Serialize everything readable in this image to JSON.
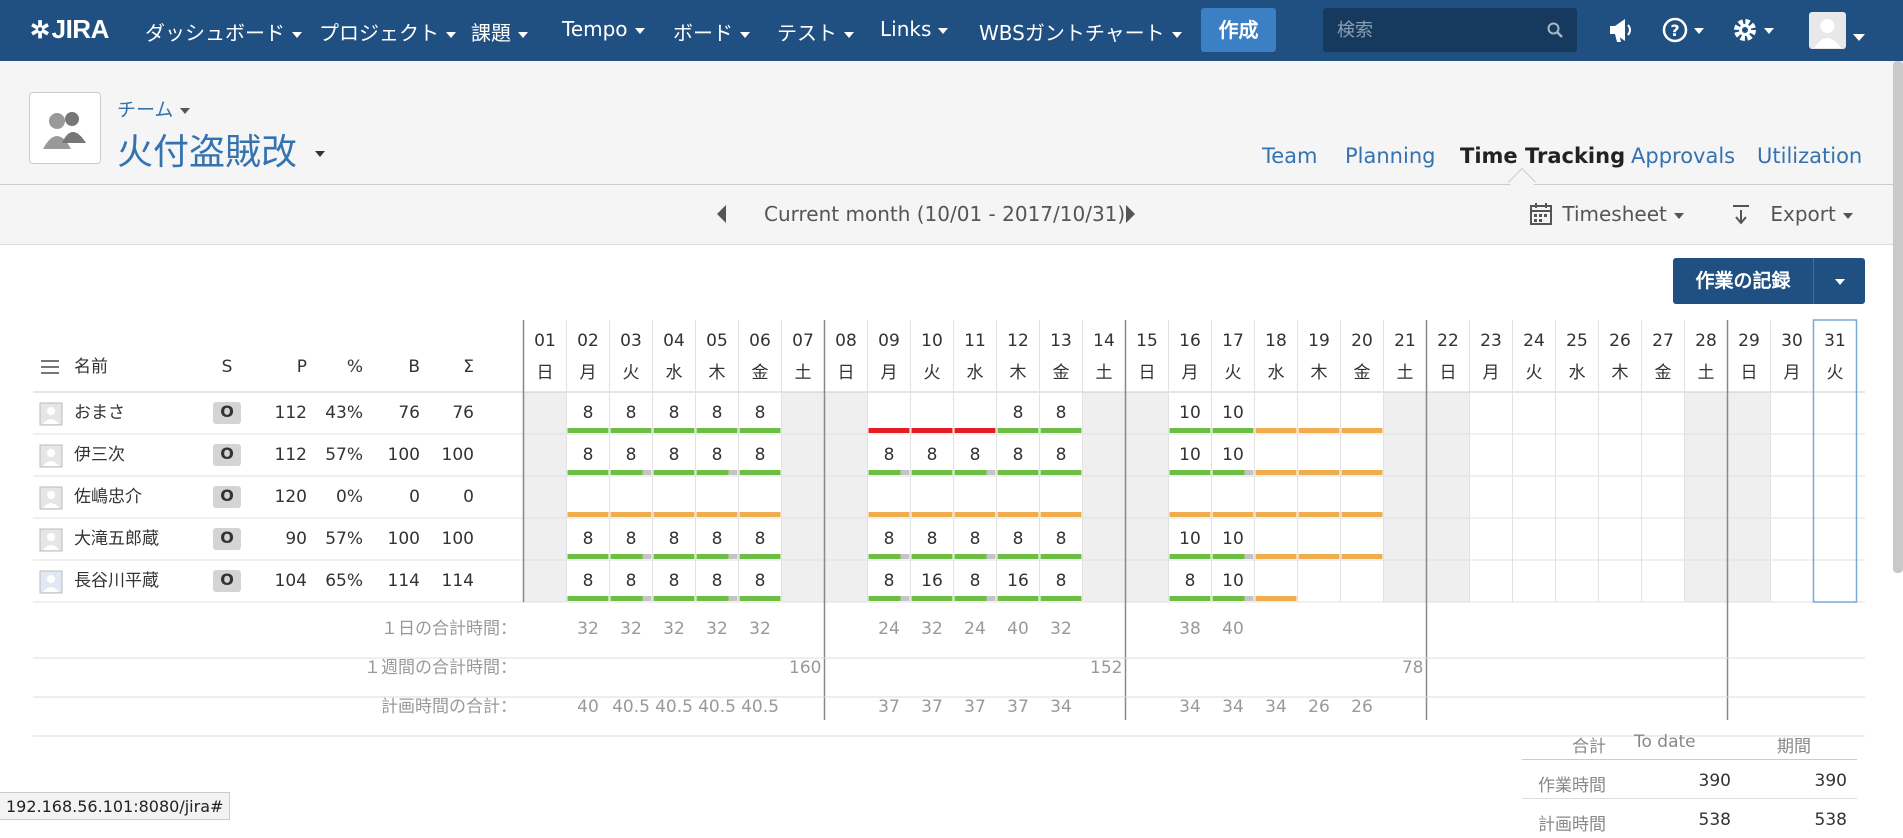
{
  "nav": {
    "logo": "JIRA",
    "items": [
      {
        "label": "ダッシュボード",
        "caret": true
      },
      {
        "label": "プロジェクト",
        "caret": true
      },
      {
        "label": "課題",
        "caret": true
      },
      {
        "label": "Tempo",
        "caret": true
      },
      {
        "label": "ボード",
        "caret": true
      },
      {
        "label": "テスト",
        "caret": true
      },
      {
        "label": "Links",
        "caret": true
      },
      {
        "label": "WBSガントチャート",
        "caret": true
      }
    ],
    "create_label": "作成",
    "search_placeholder": "検索",
    "icons": [
      "megaphone-icon",
      "help-icon",
      "gear-icon",
      "user-avatar"
    ]
  },
  "team": {
    "label": "チーム",
    "name": "火付盗賊改",
    "tabs": [
      {
        "label": "Team",
        "active": false
      },
      {
        "label": "Planning",
        "active": false
      },
      {
        "label": "Time Tracking",
        "active": true
      },
      {
        "label": "Approvals",
        "active": false
      },
      {
        "label": "Utilization",
        "active": false
      }
    ]
  },
  "period": {
    "label": "Current month (10/01 - 2017/10/31)",
    "timesheet_label": "Timesheet",
    "export_label": "Export"
  },
  "log_work_label": "作業の記録",
  "grid": {
    "columns": {
      "name": "名前",
      "s": "S",
      "p": "P",
      "pct": "%",
      "b": "B",
      "sigma": "Σ"
    },
    "days": [
      "01",
      "02",
      "03",
      "04",
      "05",
      "06",
      "07",
      "08",
      "09",
      "10",
      "11",
      "12",
      "13",
      "14",
      "15",
      "16",
      "17",
      "18",
      "19",
      "20",
      "21",
      "22",
      "23",
      "24",
      "25",
      "26",
      "27",
      "28",
      "29",
      "30",
      "31"
    ],
    "weekdays": [
      "日",
      "月",
      "火",
      "水",
      "木",
      "金",
      "土",
      "日",
      "月",
      "火",
      "水",
      "木",
      "金",
      "土",
      "日",
      "月",
      "火",
      "水",
      "木",
      "金",
      "土",
      "日",
      "月",
      "火",
      "水",
      "木",
      "金",
      "土",
      "日",
      "月",
      "火"
    ],
    "rows": [
      {
        "name": "おまさ",
        "s": "O",
        "p": "112",
        "pct": "43%",
        "b": "76",
        "sigma": "76",
        "hours": {
          "02": "8",
          "03": "8",
          "04": "8",
          "05": "8",
          "06": "8",
          "12": "8",
          "13": "8",
          "16": "10",
          "17": "10"
        }
      },
      {
        "name": "伊三次",
        "s": "O",
        "p": "112",
        "pct": "57%",
        "b": "100",
        "sigma": "100",
        "hours": {
          "02": "8",
          "03": "8",
          "04": "8",
          "05": "8",
          "06": "8",
          "09": "8",
          "10": "8",
          "11": "8",
          "12": "8",
          "13": "8",
          "16": "10",
          "17": "10"
        }
      },
      {
        "name": "佐嶋忠介",
        "s": "O",
        "p": "120",
        "pct": "0%",
        "b": "0",
        "sigma": "0",
        "hours": {}
      },
      {
        "name": "大滝五郎蔵",
        "s": "O",
        "p": "90",
        "pct": "57%",
        "b": "100",
        "sigma": "100",
        "hours": {
          "02": "8",
          "03": "8",
          "04": "8",
          "05": "8",
          "06": "8",
          "09": "8",
          "10": "8",
          "11": "8",
          "12": "8",
          "13": "8",
          "16": "10",
          "17": "10"
        }
      },
      {
        "name": "長谷川平蔵",
        "s": "O",
        "p": "104",
        "pct": "65%",
        "b": "114",
        "sigma": "114",
        "hours": {
          "02": "8",
          "03": "8",
          "04": "8",
          "05": "8",
          "06": "8",
          "09": "8",
          "10": "16",
          "11": "8",
          "12": "16",
          "13": "8",
          "16": "8",
          "17": "10"
        }
      }
    ],
    "daily_total_label": "１日の合計時間：",
    "daily_totals": {
      "02": "32",
      "03": "32",
      "04": "32",
      "05": "32",
      "06": "32",
      "09": "24",
      "10": "32",
      "11": "24",
      "12": "40",
      "13": "32",
      "16": "38",
      "17": "40"
    },
    "weekly_total_label": "１週間の合計時間：",
    "weekly_totals": {
      "07": "160",
      "14": "152",
      "21": "78"
    },
    "planned_total_label": "計画時間の合計：",
    "planned_totals": {
      "02": "40",
      "03": "40.5",
      "04": "40.5",
      "05": "40.5",
      "06": "40.5",
      "09": "37",
      "10": "37",
      "11": "37",
      "12": "37",
      "13": "34",
      "16": "34",
      "17": "34",
      "18": "34",
      "19": "26",
      "20": "26"
    }
  },
  "summary": {
    "headers": [
      "合計",
      "To date",
      "期間"
    ],
    "rows": [
      {
        "label": "作業時間",
        "to_date": "390",
        "period": "390"
      },
      {
        "label": "計画時間",
        "to_date": "538",
        "period": "538"
      }
    ]
  },
  "status_url": "192.168.56.101:8080/jira#",
  "colors": {
    "nav_bg": "#205081",
    "link": "#3572b0",
    "green": "#6cbf44",
    "orange": "#f0ad4e",
    "red": "#e51c23",
    "gray": "#c4c4c4"
  }
}
